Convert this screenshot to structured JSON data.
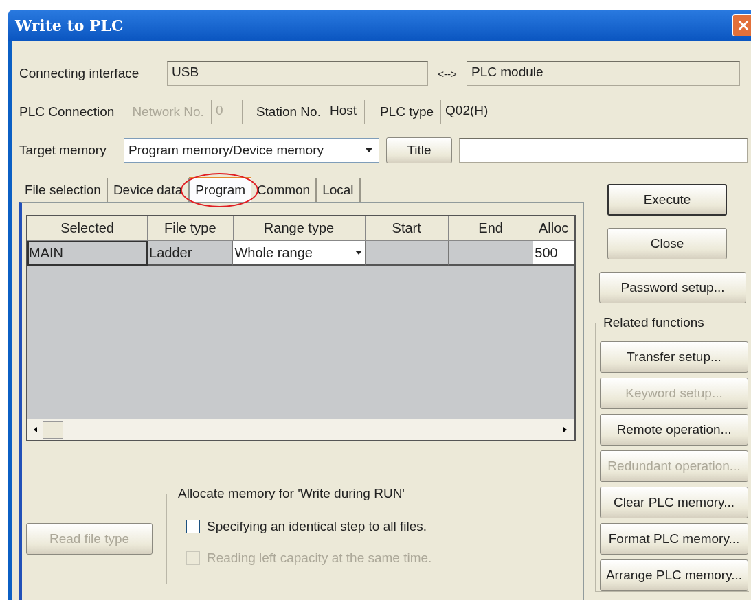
{
  "window": {
    "title": "Write to PLC"
  },
  "connection": {
    "interface_label": "Connecting interface",
    "interface_value": "USB",
    "arrow": "<-->",
    "target_value": "PLC module"
  },
  "plc_connection": {
    "label": "PLC Connection",
    "network_label": "Network No.",
    "network_value": "0",
    "network_disabled": true,
    "station_label": "Station No.",
    "station_value": "Host",
    "plc_type_label": "PLC type",
    "plc_type_value": "Q02(H)"
  },
  "target_memory": {
    "label": "Target memory",
    "value": "Program memory/Device memory",
    "title_button": "Title"
  },
  "tabs": [
    {
      "label": "File selection",
      "selected": false,
      "highlighted": false
    },
    {
      "label": "Device data",
      "selected": false,
      "highlighted": false
    },
    {
      "label": "Program",
      "selected": true,
      "highlighted": true
    },
    {
      "label": "Common",
      "selected": false,
      "highlighted": false
    },
    {
      "label": "Local",
      "selected": false,
      "highlighted": false
    }
  ],
  "table": {
    "columns": [
      "Selected",
      "File type",
      "Range type",
      "Start",
      "End",
      "Alloc"
    ],
    "rows": [
      {
        "selected": true,
        "cells": [
          {
            "kind": "text",
            "text": "MAIN"
          },
          {
            "kind": "text",
            "text": "Ladder"
          },
          {
            "kind": "dropdown",
            "text": "Whole range"
          },
          {
            "kind": "empty"
          },
          {
            "kind": "empty"
          },
          {
            "kind": "input",
            "text": "500"
          }
        ]
      }
    ]
  },
  "read_file_type": {
    "label": "Read file type",
    "disabled": true
  },
  "write_during_run": {
    "title": "Allocate memory for 'Write during RUN'",
    "options": [
      {
        "label": "Specifying an identical step to all files.",
        "checked": false,
        "disabled": false
      },
      {
        "label": "Reading left capacity at the same time.",
        "checked": false,
        "disabled": true
      }
    ]
  },
  "actions": [
    {
      "label": "Execute",
      "default": true,
      "disabled": false
    },
    {
      "label": "Close",
      "default": false,
      "disabled": false
    },
    {
      "label": "Password setup...",
      "default": false,
      "disabled": false
    }
  ],
  "related_functions": {
    "title": "Related functions",
    "buttons": [
      {
        "label": "Transfer setup...",
        "disabled": false
      },
      {
        "label": "Keyword setup...",
        "disabled": true
      },
      {
        "label": "Remote operation...",
        "disabled": false
      },
      {
        "label": "Redundant operation...",
        "disabled": true
      },
      {
        "label": "Clear PLC memory...",
        "disabled": false
      },
      {
        "label": "Format PLC memory...",
        "disabled": false
      },
      {
        "label": "Arrange PLC memory...",
        "disabled": false
      }
    ]
  }
}
